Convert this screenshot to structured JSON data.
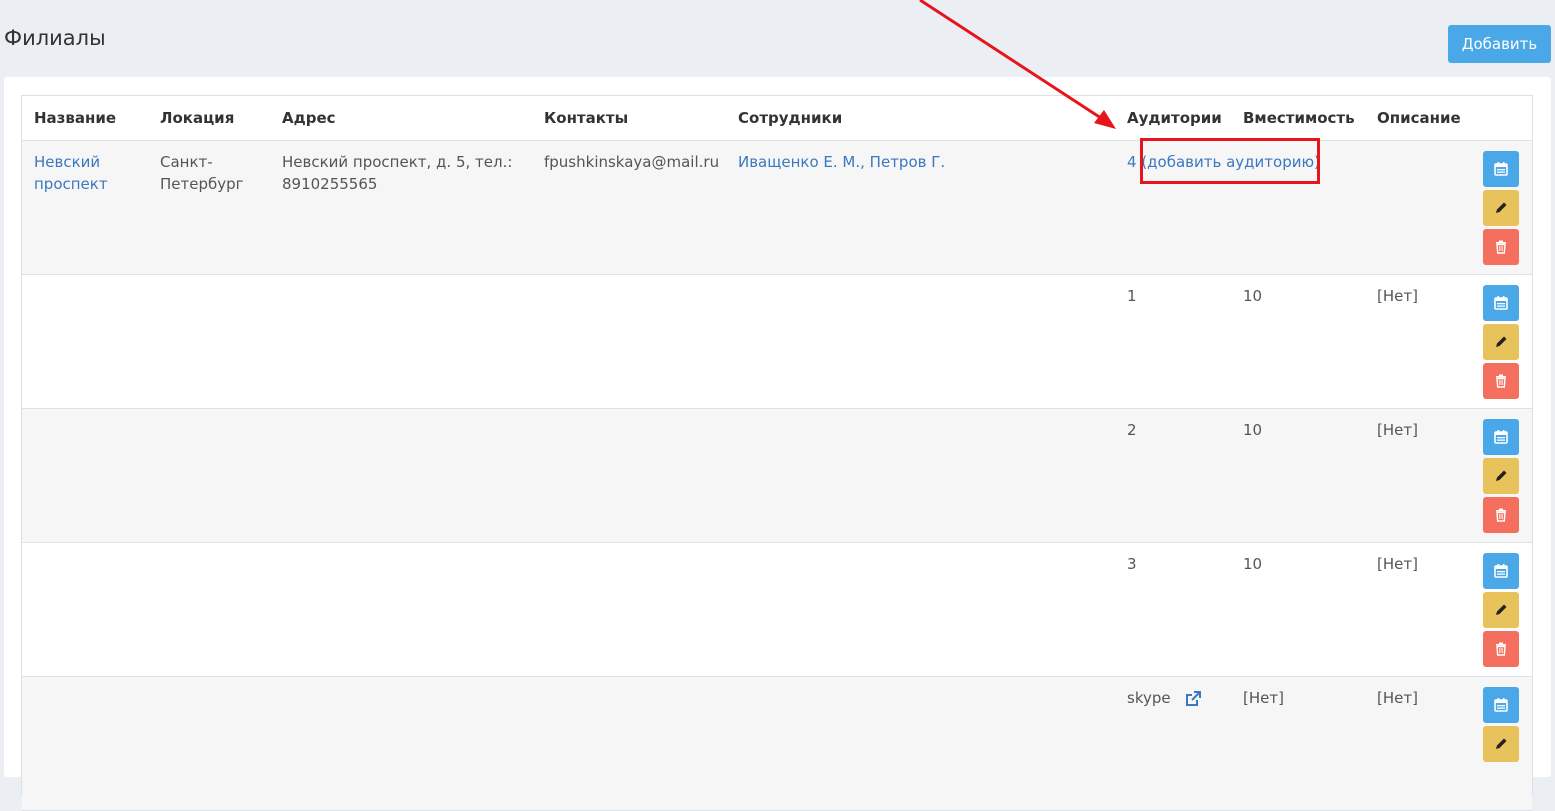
{
  "page": {
    "title": "Филиалы",
    "add_button": "Добавить"
  },
  "table": {
    "headers": {
      "name": "Название",
      "location": "Локация",
      "address": "Адрес",
      "contacts": "Контакты",
      "staff": "Сотрудники",
      "rooms": "Аудитории",
      "capacity": "Вместимость",
      "description": "Описание"
    },
    "branch": {
      "name_line1": "Невский",
      "name_line2": "проспект",
      "location_line1": "Санкт-",
      "location_line2": "Петербург",
      "address_line1": "Невский проспект, д. 5, тел.:",
      "address_line2": "8910255565",
      "contacts": "fpushkinskaya@mail.ru",
      "staff": "Иващенко Е. М., Петров Г.",
      "rooms_count": "4",
      "add_room_open": " (",
      "add_room_link": "добавить аудиторию",
      "add_room_close": ")"
    },
    "rooms": [
      {
        "name": "1",
        "capacity": "10",
        "description": "[Нет]"
      },
      {
        "name": "2",
        "capacity": "10",
        "description": "[Нет]"
      },
      {
        "name": "3",
        "capacity": "10",
        "description": "[Нет]"
      },
      {
        "name": "skype",
        "capacity": "[Нет]",
        "description": "[Нет]"
      }
    ]
  },
  "colors": {
    "primary": "#4aa8e8",
    "warning": "#e8c25a",
    "danger": "#f46f5e",
    "link": "#3a78c0",
    "annotation": "#e8141c"
  },
  "icons": {
    "schedule": "calendar-icon",
    "edit": "pencil-icon",
    "delete": "trash-icon",
    "external": "external-link-icon"
  }
}
